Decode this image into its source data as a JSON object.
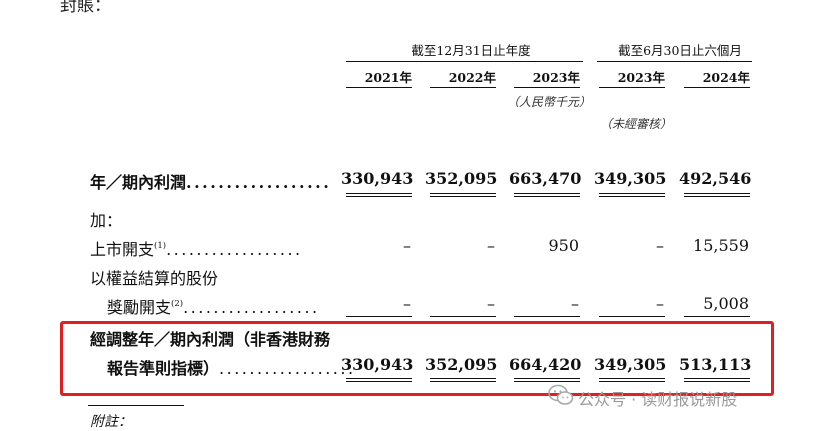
{
  "top_partial_text": "封賬：",
  "header": {
    "group1": "截至12月31日止年度",
    "group2": "截至6月30日止六個月",
    "years": [
      "2021年",
      "2022年",
      "2023年",
      "2023年",
      "2024年"
    ],
    "currency_note": "（人民幣千元）",
    "audit_note": "（未經審核）"
  },
  "rows": {
    "profit": {
      "label": "年／期內利潤",
      "values": [
        "330,943",
        "352,095",
        "663,470",
        "349,305",
        "492,546"
      ]
    },
    "add": {
      "label": "加："
    },
    "listing": {
      "label": "上市開支",
      "footnote_ref": "(1)",
      "values": [
        "–",
        "–",
        "950",
        "–",
        "15,559"
      ]
    },
    "share_comp_line1": {
      "label": "以權益結算的股份"
    },
    "share_comp_line2": {
      "label": "獎勵開支",
      "footnote_ref": "(2)",
      "values": [
        "–",
        "–",
        "–",
        "–",
        "5,008"
      ]
    },
    "adjusted_line1": {
      "label": "經調整年／期內利潤（非香港財務"
    },
    "adjusted_line2": {
      "label": "報告準則指標）",
      "values": [
        "330,943",
        "352,095",
        "664,420",
        "349,305",
        "513,113"
      ]
    }
  },
  "dot_leader": "..................",
  "footnote_label": "附註：",
  "watermark": "公众号 · 读财报说新股",
  "colors": {
    "highlight": "#e02020",
    "watermark": "#9a9a9a"
  }
}
